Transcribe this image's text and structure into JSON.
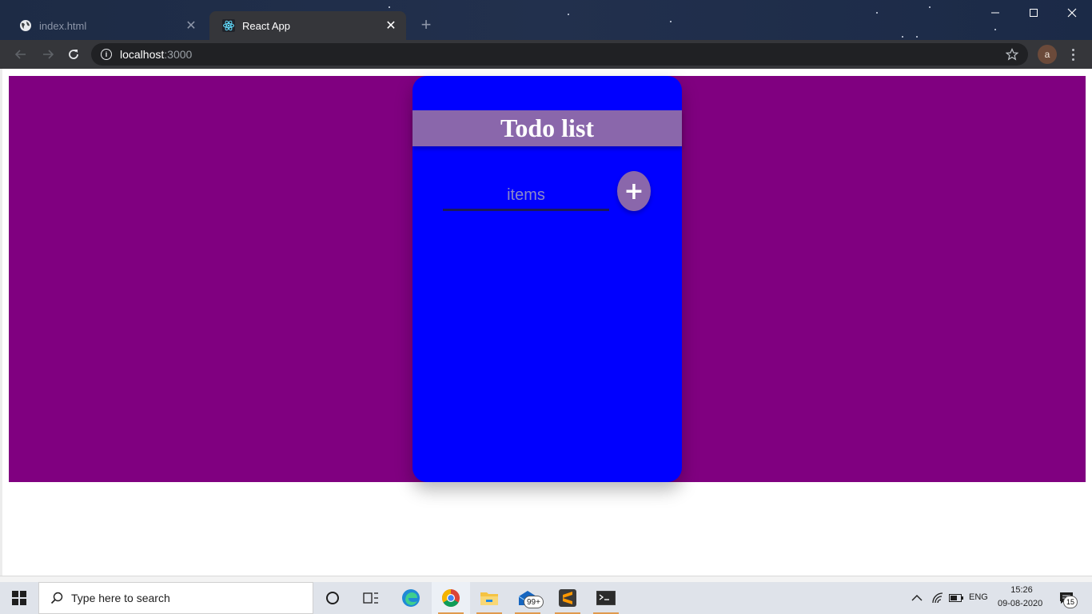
{
  "browser": {
    "tabs": [
      {
        "title": "index.html",
        "icon": "globe-icon",
        "active": false
      },
      {
        "title": "React App",
        "icon": "react-icon",
        "active": true
      }
    ],
    "address": {
      "host": "localhost",
      "port": ":3000"
    }
  },
  "profile": {
    "initial": "a"
  },
  "app": {
    "title": "Todo list",
    "input_placeholder": "items",
    "add_label": "+"
  },
  "colors": {
    "page_background": "#800080",
    "card": "#0000ff",
    "header_bar": "#8a67ab",
    "add_button": "#8a67ab"
  },
  "taskbar": {
    "search_placeholder": "Type here to search",
    "mail_badge": "99+",
    "language": "ENG",
    "time": "15:26",
    "date": "09-08-2020",
    "notifications": "15"
  }
}
